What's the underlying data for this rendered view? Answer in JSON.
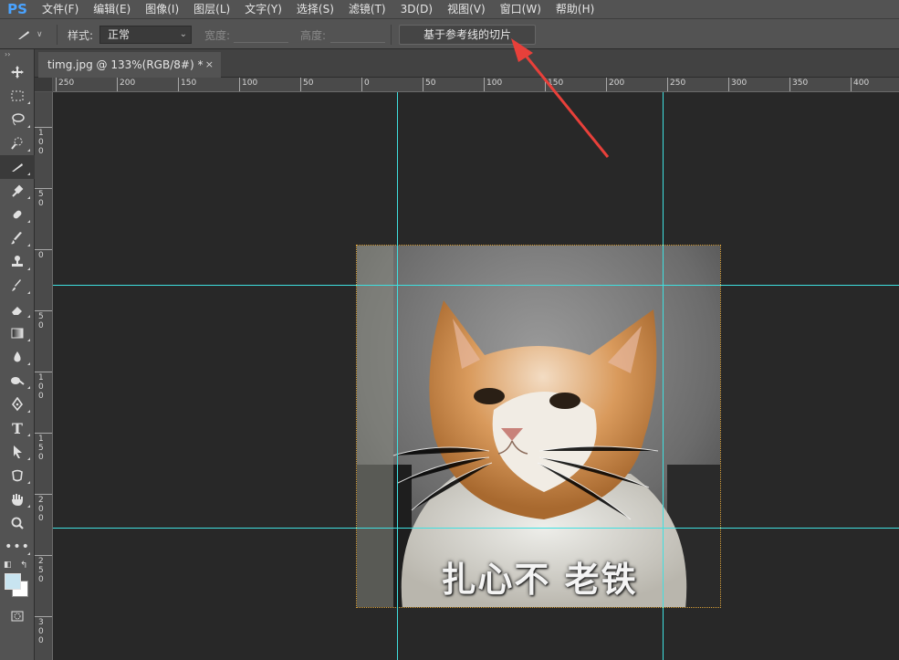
{
  "app": {
    "logo": "PS"
  },
  "menu": [
    "文件(F)",
    "编辑(E)",
    "图像(I)",
    "图层(L)",
    "文字(Y)",
    "选择(S)",
    "滤镜(T)",
    "3D(D)",
    "视图(V)",
    "窗口(W)",
    "帮助(H)"
  ],
  "options": {
    "style_label": "样式:",
    "style_value": "正常",
    "width_label": "宽度:",
    "height_label": "高度:",
    "slice_button": "基于参考线的切片"
  },
  "document": {
    "tab_title": "timg.jpg @ 133%(RGB/8#) *",
    "close_symbol": "×",
    "caption": "扎心不 老铁"
  },
  "ruler": {
    "h_labels": [
      "250",
      "200",
      "150",
      "100",
      "50",
      "0",
      "50",
      "100",
      "150",
      "200",
      "250",
      "300",
      "350",
      "400"
    ],
    "v_labels": [
      "100",
      "50",
      "0",
      "50",
      "100",
      "150",
      "200",
      "250",
      "300"
    ]
  },
  "toolbar": {
    "tools": [
      "move-icon",
      "marquee-icon",
      "lasso-icon",
      "quick-select-icon",
      "slice-icon",
      "eyedropper-icon",
      "healing-brush-icon",
      "brush-icon",
      "clone-stamp-icon",
      "history-brush-icon",
      "eraser-icon",
      "gradient-icon",
      "blur-icon",
      "dodge-icon",
      "pen-icon",
      "type-icon",
      "path-select-icon",
      "shape-icon",
      "hand-icon",
      "zoom-icon",
      "more-tools-icon"
    ],
    "foreground_color": "#c8e4f0",
    "background_color": "#ffffff",
    "active_tool": "slice-icon"
  },
  "colors": {
    "guide": "#3fe0e0",
    "annotation_arrow": "#e8403a"
  }
}
